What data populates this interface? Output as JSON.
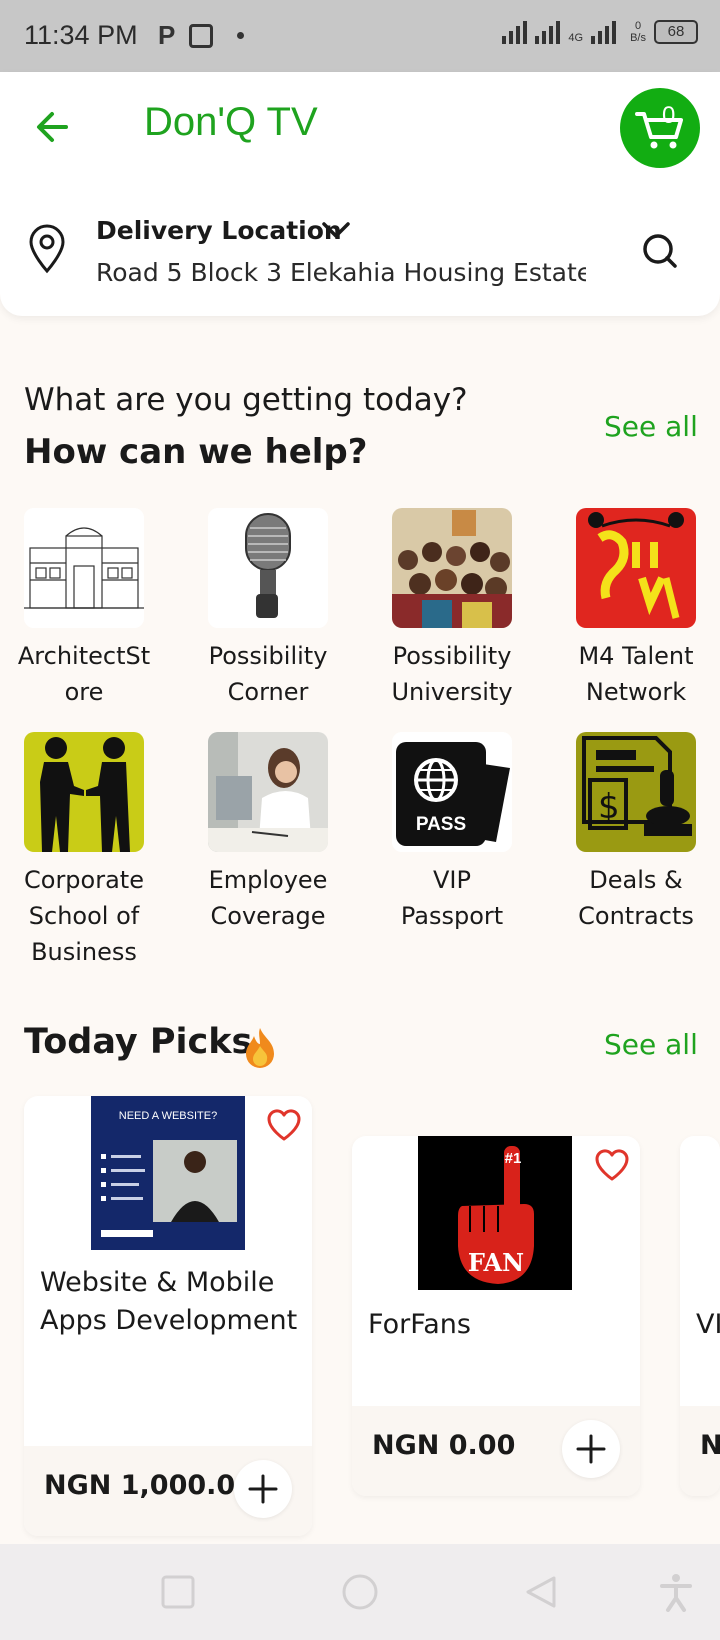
{
  "status_bar": {
    "time": "11:34 PM",
    "left_icons": [
      "parking-p-icon",
      "notification-box-icon",
      "dot-icon"
    ],
    "network_type": "4G",
    "data_rate_value": "0",
    "data_rate_unit": "B/s",
    "battery": "68"
  },
  "header": {
    "title": "Don'Q TV",
    "cart_count": "0",
    "brand_color": "#12ad12"
  },
  "location": {
    "label": "Delivery Location",
    "address": "Road 5 Block 3 Elekahia Housing Estate ..."
  },
  "help_section": {
    "subtitle": "What are you getting today?",
    "title": "How can we help?",
    "see_all": "See all",
    "categories": [
      {
        "label": "ArchitectSt ore",
        "line1": "ArchitectSt",
        "line2": "ore",
        "icon": "architecture-drawing-image"
      },
      {
        "label": "Possibility Corner",
        "line1": "Possibility",
        "line2": "Corner",
        "icon": "microphone-image"
      },
      {
        "label": "Possibility University",
        "line1": "Possibility",
        "line2": "University",
        "icon": "group-photo-image"
      },
      {
        "label": "M4 Talent Network",
        "line1": "M4 Talent",
        "line2": "Network",
        "icon": "show-us-your-talent-image"
      },
      {
        "label": "Corporate School of Business",
        "line1": "Corporate",
        "line2": "School of",
        "line3": "Business",
        "icon": "handshake-silhouette-image"
      },
      {
        "label": "Employee Coverage",
        "line1": "Employee",
        "line2": "Coverage",
        "icon": "woman-at-desk-image"
      },
      {
        "label": "VIP Passport",
        "line1": "VIP",
        "line2": "Passport",
        "icon": "passport-image",
        "badge_text": "PASS"
      },
      {
        "label": "Deals & Contracts",
        "line1": "Deals &",
        "line2": "Contracts",
        "icon": "contract-stamp-image"
      }
    ]
  },
  "picks_section": {
    "title": "Today Picks",
    "see_all": "See all",
    "items": [
      {
        "name_line1": "Website & Mobile",
        "name_line2": "Apps Development",
        "price": "NGN 1,000.00",
        "image_caption": "NEED A WEBSITE?"
      },
      {
        "name_line1": "ForFans",
        "name_line2": "",
        "price": "NGN 0.00",
        "image_caption": "FAN",
        "image_badge": "#1"
      },
      {
        "name_line1": "VI",
        "price": "N"
      }
    ]
  },
  "colors": {
    "accent_green": "#1fa31f",
    "heart_red": "#e0352b",
    "background": "#fdf9f5"
  }
}
